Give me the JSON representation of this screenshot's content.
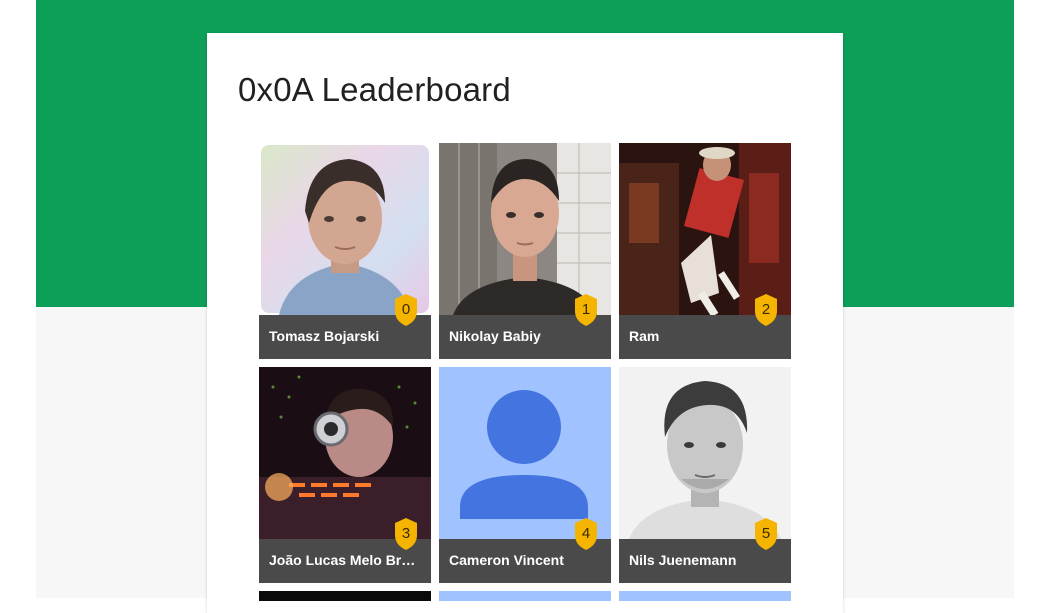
{
  "leaderboard": {
    "title": "0x0A Leaderboard",
    "entries": [
      {
        "rank": "0",
        "name": "Tomasz Bojarski"
      },
      {
        "rank": "1",
        "name": "Nikolay Babiy"
      },
      {
        "rank": "2",
        "name": "Ram"
      },
      {
        "rank": "3",
        "name": "João Lucas Melo Brasio"
      },
      {
        "rank": "4",
        "name": "Cameron Vincent"
      },
      {
        "rank": "5",
        "name": "Nils Juenemann"
      }
    ]
  },
  "colors": {
    "header_green": "#0d9e57",
    "name_bar": "#4a4a4a",
    "badge_gold": "#f4b400",
    "placeholder_bg": "#a0c3ff",
    "placeholder_fg": "#4374e0"
  }
}
